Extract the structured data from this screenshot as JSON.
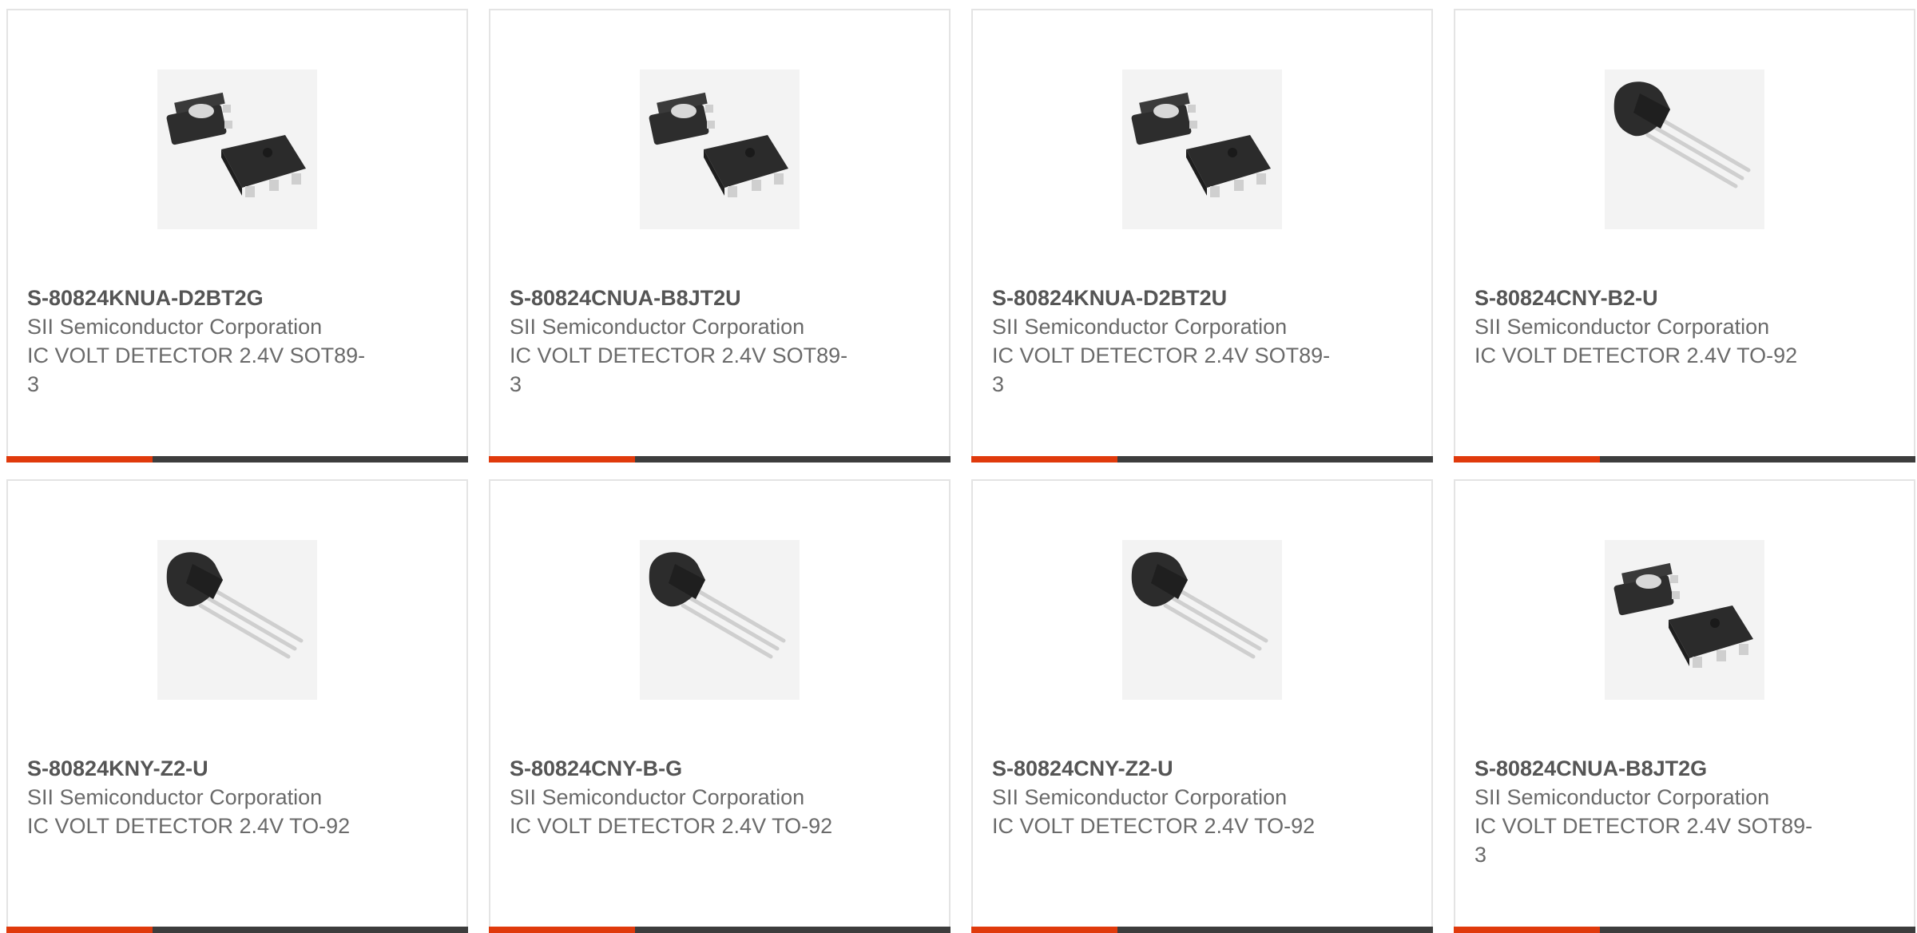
{
  "colors": {
    "accent": "#e03a0c",
    "bar": "#3d3d3d",
    "border": "#e4e4e4",
    "text": "#6a6a6a"
  },
  "products": [
    {
      "part_number": "S-80824KNUA-D2BT2G",
      "manufacturer": "SII Semiconductor Corporation",
      "description": "IC VOLT DETECTOR 2.4V SOT89-3",
      "image_icon": "sot89-package-icon"
    },
    {
      "part_number": "S-80824CNUA-B8JT2U",
      "manufacturer": "SII Semiconductor Corporation",
      "description": "IC VOLT DETECTOR 2.4V SOT89-3",
      "image_icon": "sot89-package-icon"
    },
    {
      "part_number": "S-80824KNUA-D2BT2U",
      "manufacturer": "SII Semiconductor Corporation",
      "description": "IC VOLT DETECTOR 2.4V SOT89-3",
      "image_icon": "sot89-package-icon"
    },
    {
      "part_number": "S-80824CNY-B2-U",
      "manufacturer": "SII Semiconductor Corporation",
      "description": "IC VOLT DETECTOR 2.4V TO-92",
      "image_icon": "to92-package-icon"
    },
    {
      "part_number": "S-80824KNY-Z2-U",
      "manufacturer": "SII Semiconductor Corporation",
      "description": "IC VOLT DETECTOR 2.4V TO-92",
      "image_icon": "to92-package-icon"
    },
    {
      "part_number": "S-80824CNY-B-G",
      "manufacturer": "SII Semiconductor Corporation",
      "description": "IC VOLT DETECTOR 2.4V TO-92",
      "image_icon": "to92-package-icon"
    },
    {
      "part_number": "S-80824CNY-Z2-U",
      "manufacturer": "SII Semiconductor Corporation",
      "description": "IC VOLT DETECTOR 2.4V TO-92",
      "image_icon": "to92-package-icon"
    },
    {
      "part_number": "S-80824CNUA-B8JT2G",
      "manufacturer": "SII Semiconductor Corporation",
      "description": "IC VOLT DETECTOR 2.4V SOT89-3",
      "image_icon": "sot89-package-icon"
    }
  ]
}
